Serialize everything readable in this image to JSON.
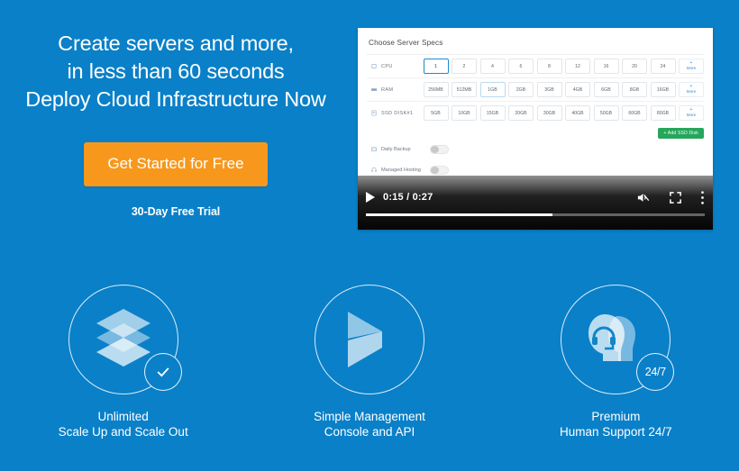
{
  "theme": {
    "background_blue": "#0a80c8",
    "cta_orange": "#f7981d",
    "add_disk_green": "#26a65b",
    "selected_border_blue": "#1b8ad6"
  },
  "hero": {
    "headline_line1": "Create servers and more,",
    "headline_line2": "in less than 60 seconds",
    "headline_line3": "Deploy Cloud Infrastructure Now",
    "cta_label": "Get Started for Free",
    "trial_note": "30-Day Free Trial"
  },
  "specs_panel": {
    "title": "Choose Server Specs",
    "more_plus": "+",
    "more_label": "More",
    "add_disk_label": "+ Add SSD Disk",
    "rows": [
      {
        "label": "CPU",
        "icon": "cpu-icon",
        "selected_index": 0,
        "options": [
          "1",
          "2",
          "4",
          "6",
          "8",
          "12",
          "16",
          "20",
          "24"
        ]
      },
      {
        "label": "RAM",
        "icon": "ram-icon",
        "hover_index": 2,
        "options": [
          "256MB",
          "512MB",
          "1GB",
          "2GB",
          "3GB",
          "4GB",
          "6GB",
          "8GB",
          "16GB"
        ]
      },
      {
        "label": "SSD DISK#1",
        "icon": "disk-icon",
        "options": [
          "5GB",
          "10GB",
          "15GB",
          "20GB",
          "30GB",
          "40GB",
          "50GB",
          "60GB",
          "80GB"
        ]
      }
    ],
    "toggles": [
      {
        "label": "Daily Backup",
        "icon": "backup-icon",
        "on": false
      },
      {
        "label": "Managed Hosting",
        "icon": "headset-icon",
        "on": false
      }
    ]
  },
  "video": {
    "play_icon": "play-icon",
    "current_time": "0:15",
    "separator": "/",
    "duration": "0:27",
    "time_display": "0:15 / 0:27",
    "mute_icon": "volume-muted-icon",
    "fullscreen_icon": "fullscreen-icon",
    "menu_icon": "kebab-menu-icon",
    "progress_percent": 55
  },
  "features": [
    {
      "icon": "stacked-layers-icon",
      "badge": "check-badge",
      "badge_text": "",
      "title": "Unlimited",
      "subtitle": "Scale Up and Scale Out"
    },
    {
      "icon": "chevron-arrow-icon",
      "badge": "",
      "badge_text": "",
      "title": "Simple Management",
      "subtitle": "Console and API"
    },
    {
      "icon": "support-head-icon",
      "badge": "text-badge",
      "badge_text": "24/7",
      "title": "Premium",
      "subtitle": "Human Support 24/7"
    }
  ]
}
